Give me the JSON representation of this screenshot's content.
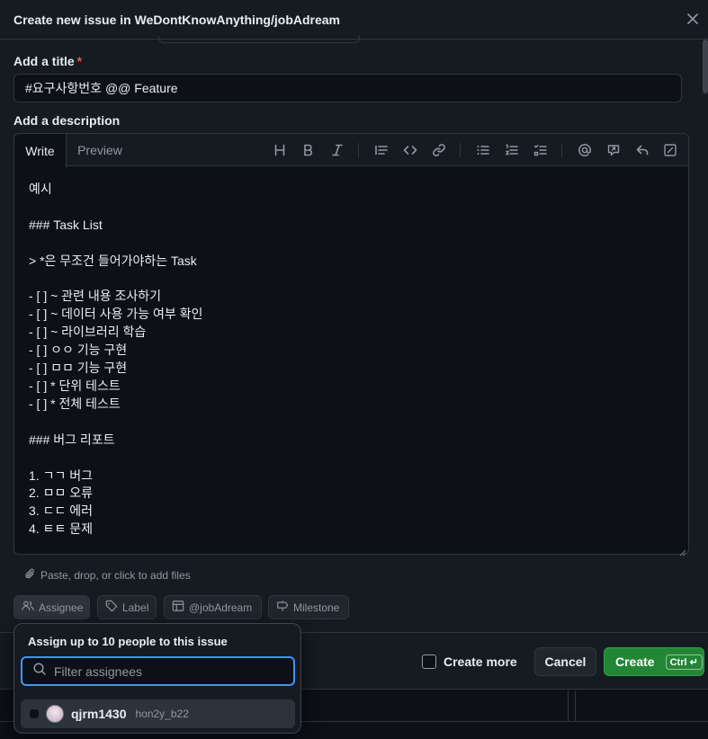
{
  "dialog": {
    "title": "Create new issue in WeDontKnowAnything/jobAdream",
    "close_icon": "x-icon"
  },
  "form": {
    "title_label": "Add a title",
    "required_mark": "*",
    "title_value": "#요구사항번호 @@ Feature",
    "description_label": "Add a description"
  },
  "editor": {
    "tabs": [
      {
        "label": "Write",
        "active": true
      },
      {
        "label": "Preview",
        "active": false
      }
    ],
    "toolbar_icons": [
      "heading-icon",
      "bold-icon",
      "italic-icon",
      "quote-icon",
      "code-icon",
      "link-icon",
      "unordered-list-icon",
      "ordered-list-icon",
      "task-list-icon",
      "mention-icon",
      "reference-icon",
      "reply-icon",
      "fullscreen-icon"
    ],
    "content": "예시\n\n### Task List\n\n> *은 무조건 들어가야하는 Task\n\n- [ ] ~ 관련 내용 조사하기\n- [ ] ~ 데이터 사용 가능 여부 확인\n- [ ] ~ 라이브러리 학습\n- [ ] ㅇㅇ 기능 구현\n- [ ] ㅁㅁ 기능 구현\n- [ ] * 단위 테스트\n- [ ] * 전체 테스트\n\n### 버그 리포트\n\n1. ㄱㄱ 버그\n2. ㅁㅁ 오류\n3. ㄷㄷ 에러\n4. ㅌㅌ 문제"
  },
  "attach": {
    "label": "Paste, drop, or click to add files"
  },
  "metadata_chips": {
    "assignee": "Assignee",
    "label": "Label",
    "project": "@jobAdream",
    "milestone": "Milestone"
  },
  "footer": {
    "create_more_label": "Create more",
    "cancel_label": "Cancel",
    "create_label": "Create",
    "shortcut": "Ctrl ↵"
  },
  "assignee_popover": {
    "title": "Assign up to 10 people to this issue",
    "filter_placeholder": "Filter assignees",
    "users": [
      {
        "name": "qjrm1430",
        "handle": "hon2y_b22"
      }
    ]
  },
  "colors": {
    "accent": "#4493f8",
    "create_button": "#238636",
    "required": "#f85149"
  }
}
